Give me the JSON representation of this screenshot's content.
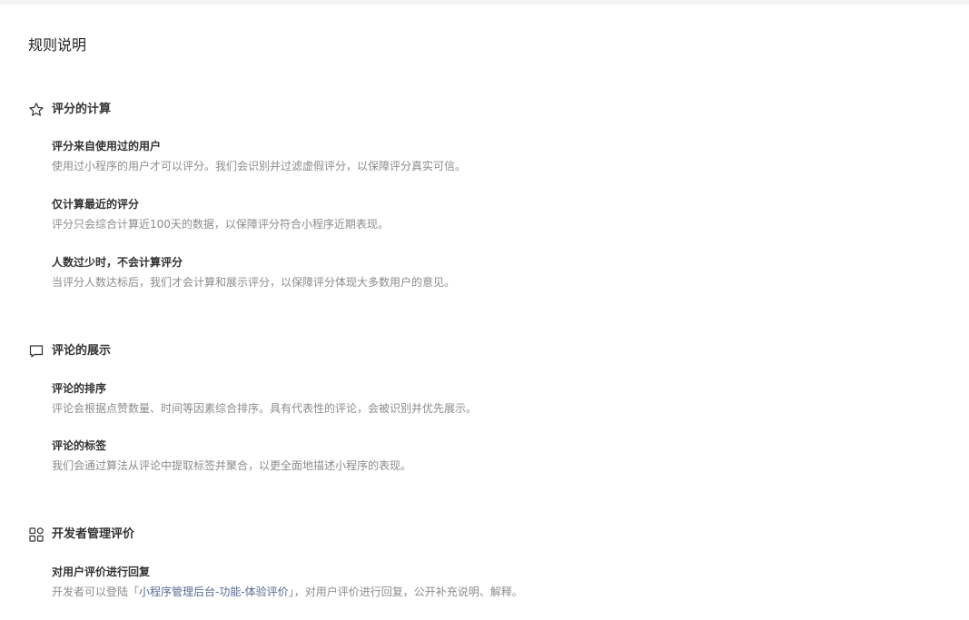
{
  "page": {
    "title": "规则说明"
  },
  "sections": [
    {
      "title": "评分的计算",
      "icon": "star-icon",
      "items": [
        {
          "title": "评分来自使用过的用户",
          "desc": "使用过小程序的用户才可以评分。我们会识别并过滤虚假评分，以保障评分真实可信。"
        },
        {
          "title": "仅计算最近的评分",
          "desc": "评分只会综合计算近100天的数据，以保障评分符合小程序近期表现。"
        },
        {
          "title": "人数过少时，不会计算评分",
          "desc": "当评分人数达标后，我们才会计算和展示评分，以保障评分体现大多数用户的意见。"
        }
      ]
    },
    {
      "title": "评论的展示",
      "icon": "comment-icon",
      "items": [
        {
          "title": "评论的排序",
          "desc": "评论会根据点赞数量、时间等因素综合排序。具有代表性的评论，会被识别并优先展示。"
        },
        {
          "title": "评论的标签",
          "desc": "我们会通过算法从评论中提取标签并聚合，以更全面地描述小程序的表现。"
        }
      ]
    },
    {
      "title": "开发者管理评价",
      "icon": "apps-icon",
      "items": [
        {
          "title": "对用户评价进行回复",
          "desc_prefix": "开发者可以登陆「",
          "desc_link": "小程序管理后台-功能-体验评价",
          "desc_suffix": "」，对用户评价进行回复，公开补充说明、解释。"
        }
      ]
    }
  ],
  "colors": {
    "title": "#222222",
    "heading": "#333333",
    "description": "#8c8c8c",
    "link": "#576b95",
    "topbar": "#f4f4f4"
  }
}
